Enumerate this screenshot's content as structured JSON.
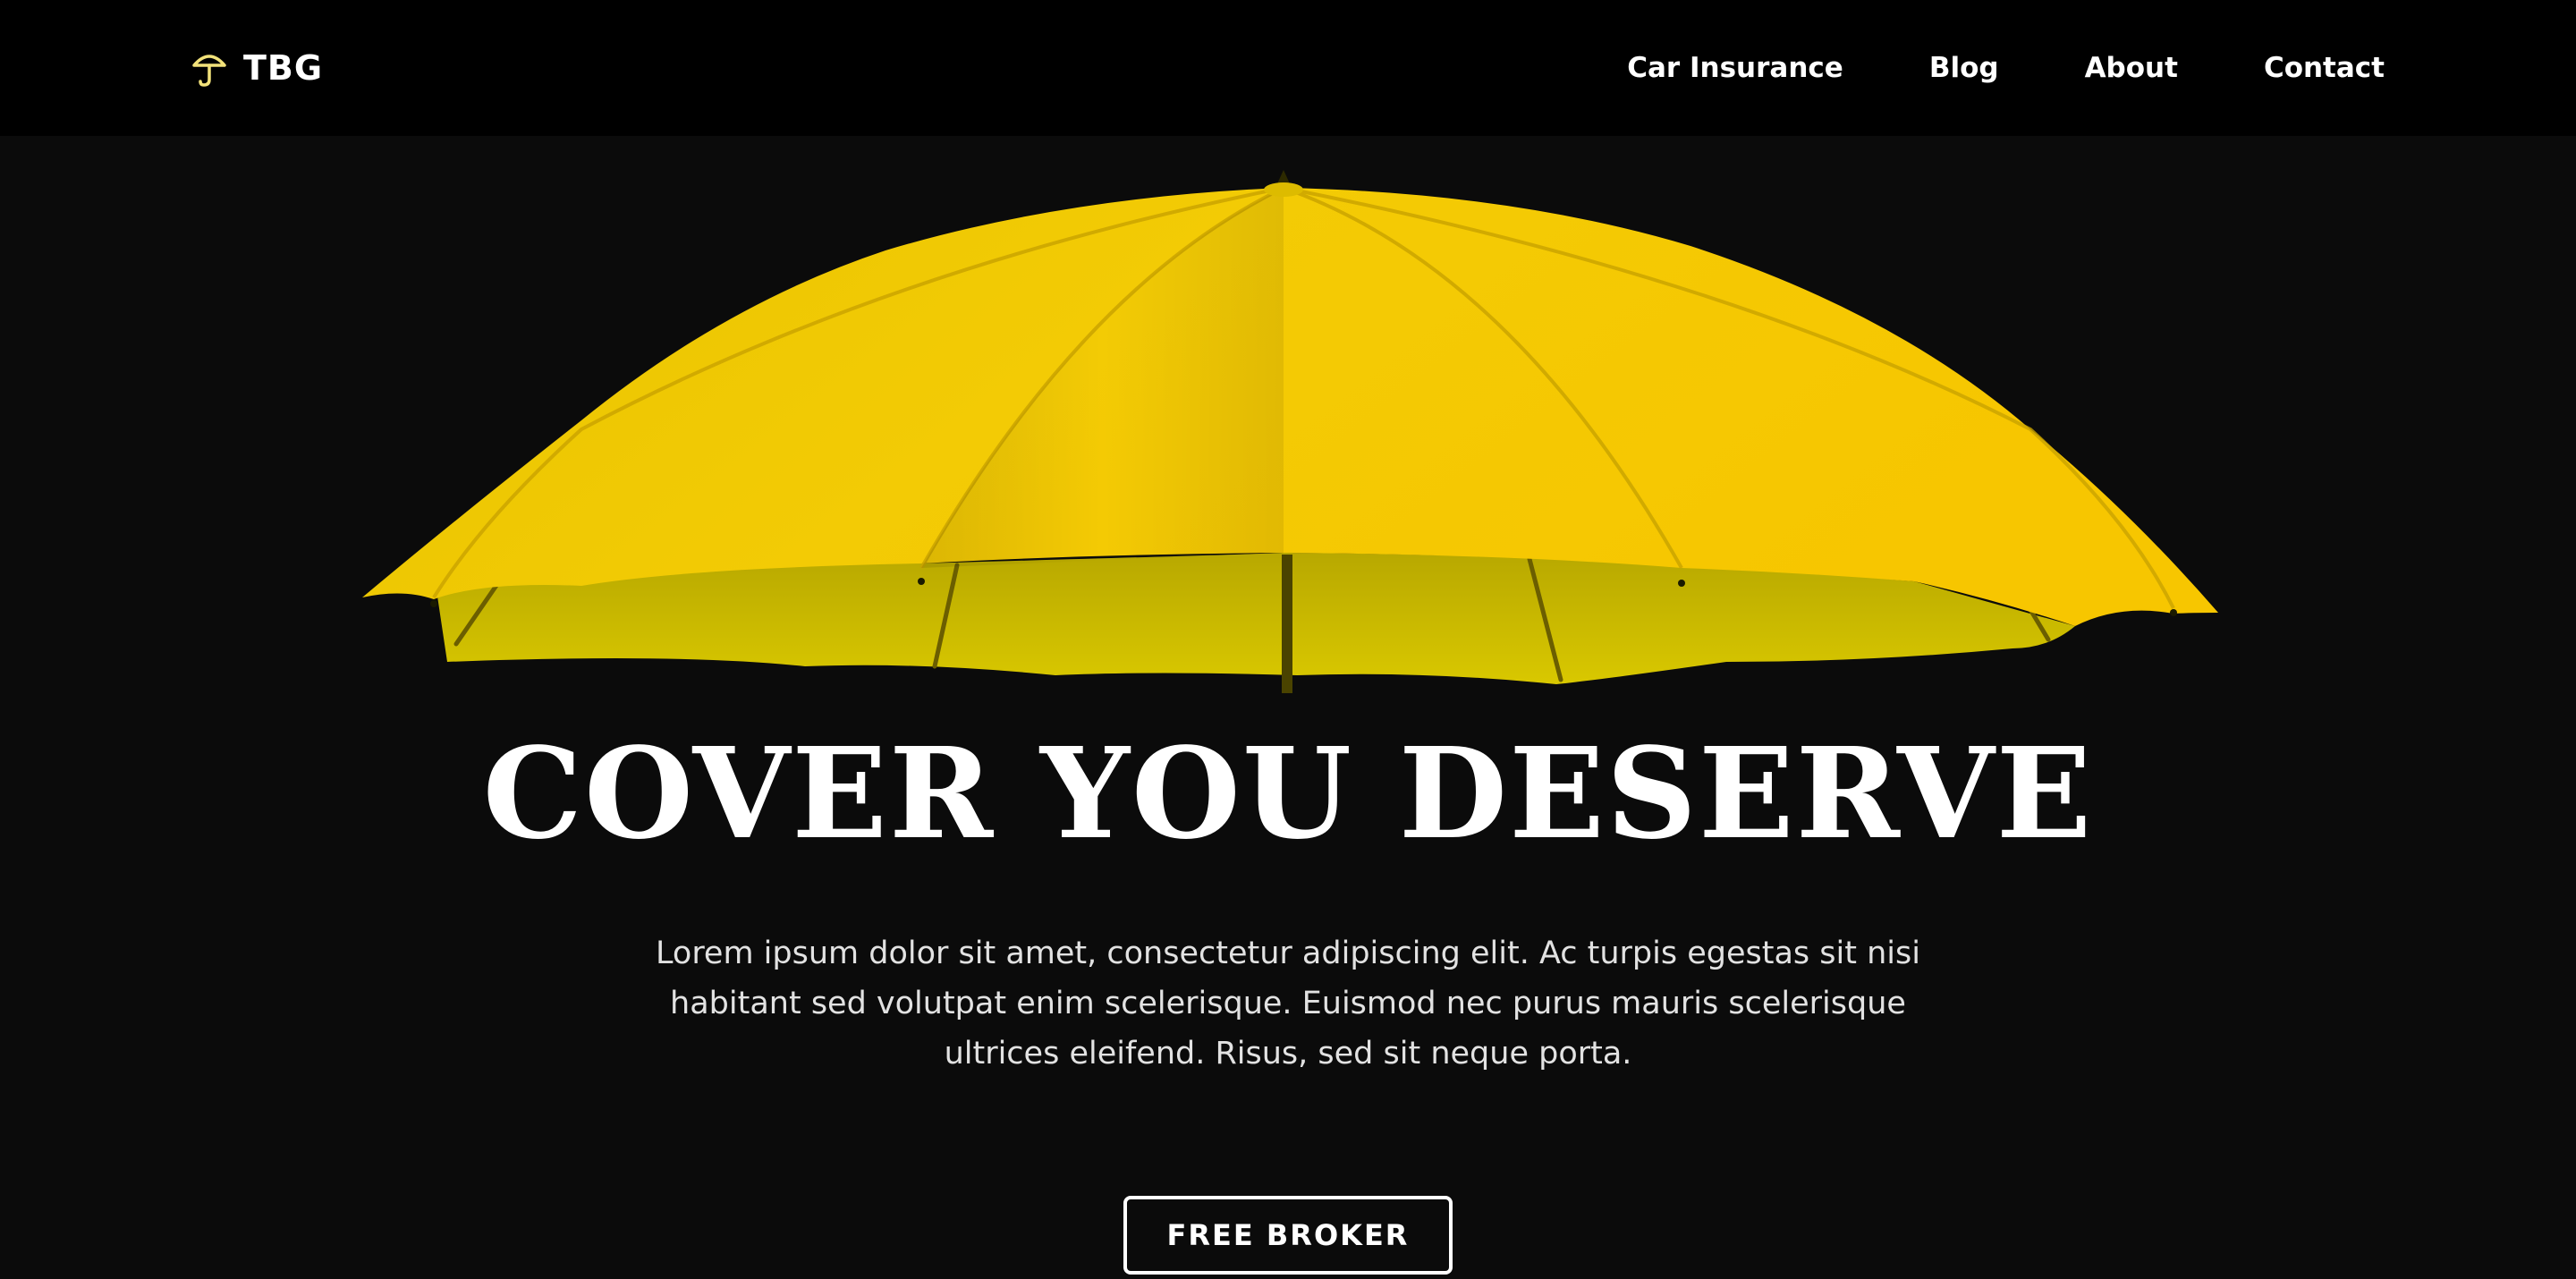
{
  "header": {
    "brand": {
      "icon": "umbrella-icon",
      "name": "TBG",
      "icon_color": "#f2e27a"
    },
    "nav": [
      {
        "label": "Car Insurance"
      },
      {
        "label": "Blog"
      },
      {
        "label": "About"
      },
      {
        "label": "Contact"
      }
    ]
  },
  "hero": {
    "image": "yellow-umbrella-image",
    "title": "COVER YOU DESERVE",
    "description": "Lorem ipsum dolor sit amet, consectetur adipiscing elit. Ac turpis egestas sit nisi habitant sed volutpat enim scelerisque. Euismod nec purus mauris scelerisque ultrices eleifend. Risus, sed sit neque porta.",
    "cta_label": "FREE BROKER"
  },
  "colors": {
    "background": "#0b0b0b",
    "nav_background": "#000000",
    "accent_yellow": "#f4c900",
    "text": "#ffffff"
  }
}
